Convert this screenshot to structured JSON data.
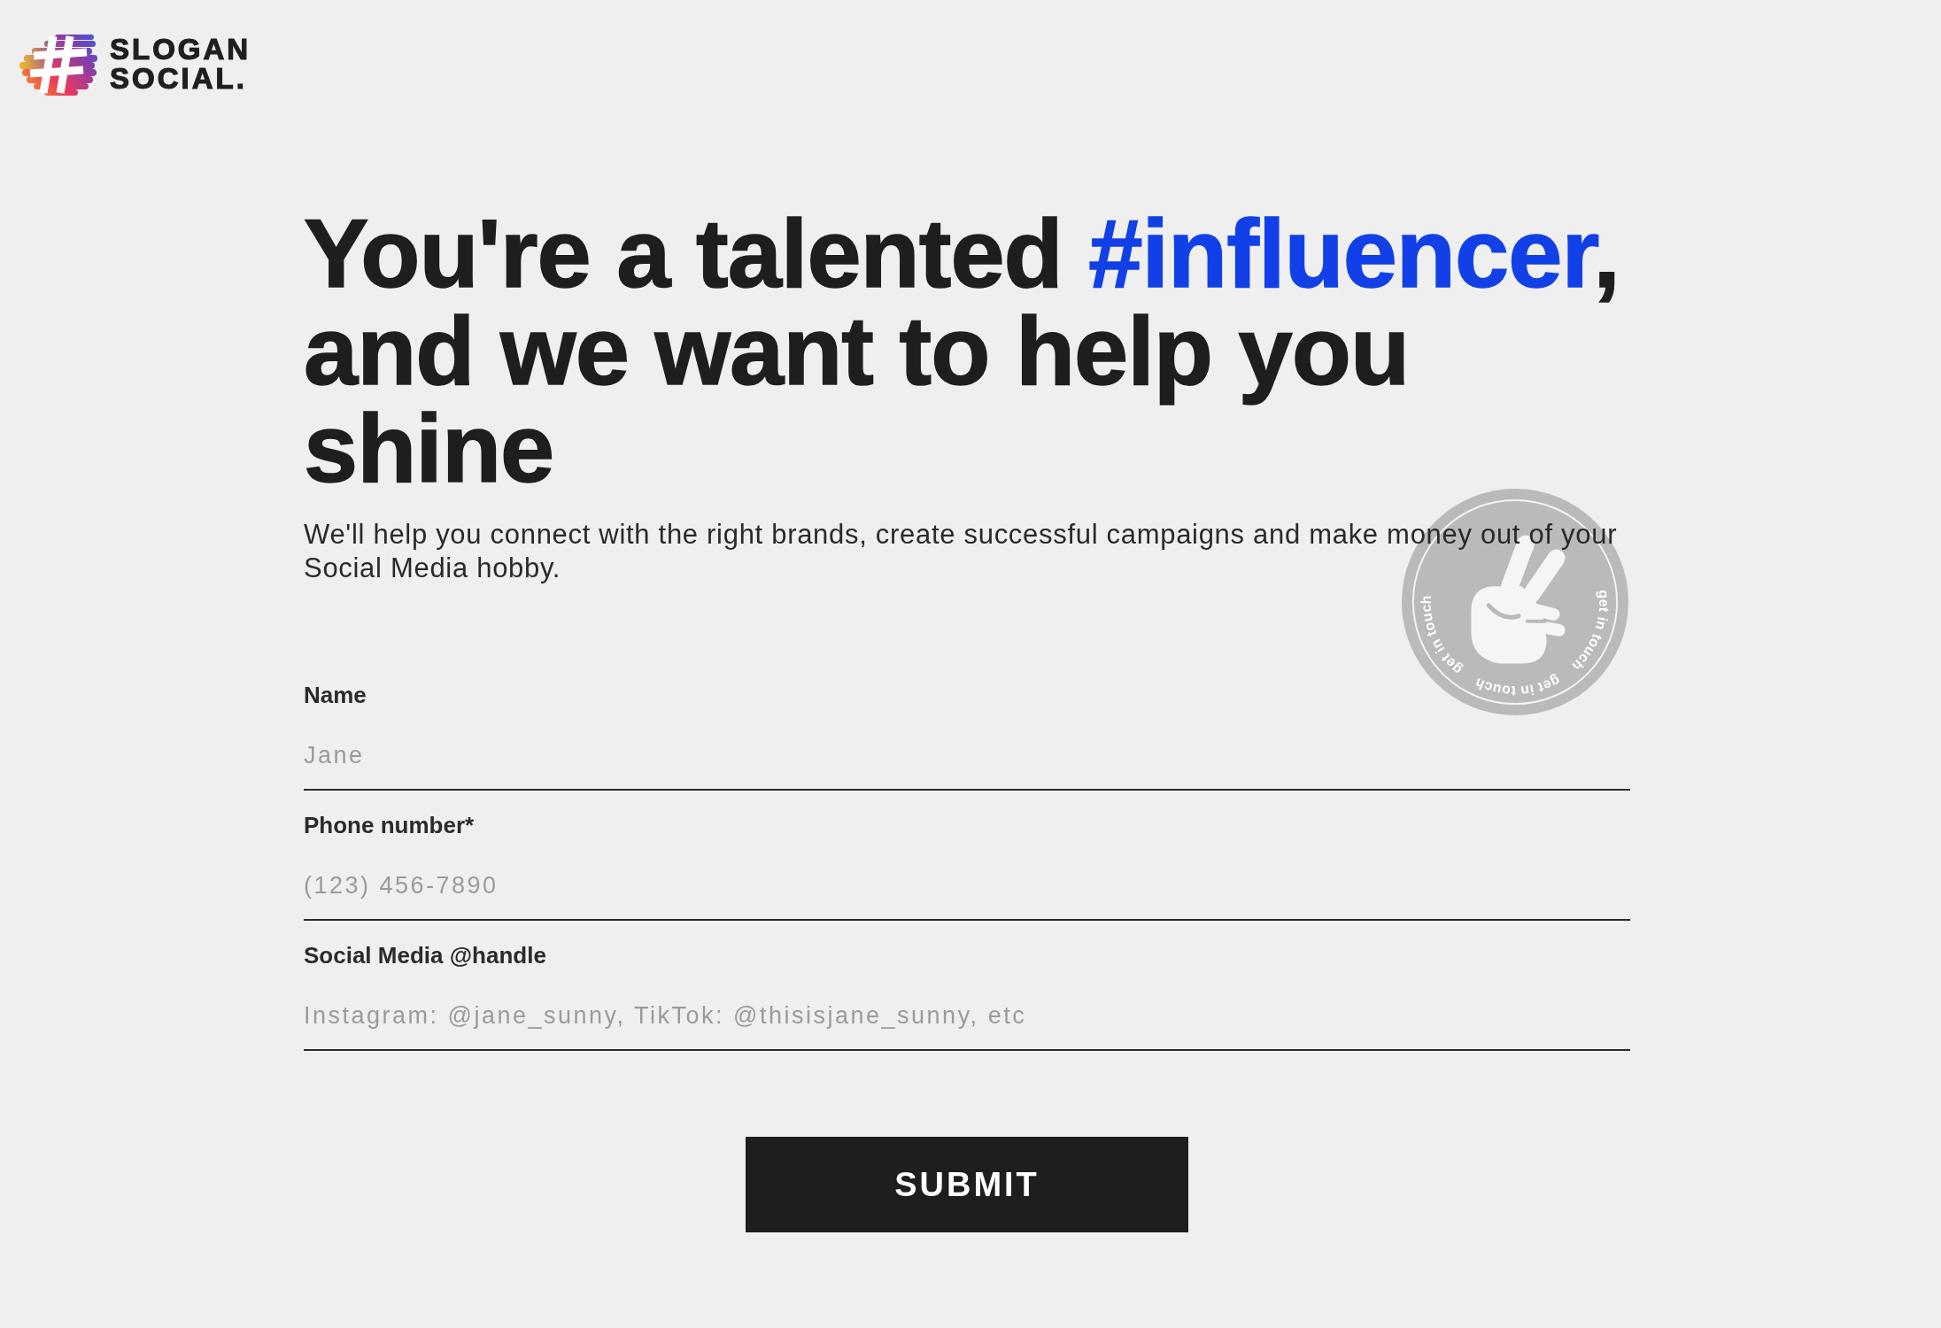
{
  "header": {
    "logo": {
      "name": "SLOGAN SOCIAL."
    }
  },
  "hero": {
    "headline": [
      {
        "text": "You're a talented ",
        "highlight": false
      },
      {
        "text": "#influencer",
        "highlight": true
      },
      {
        "text": ", and we want to help you shine",
        "highlight": false
      }
    ],
    "subtitle": "We'll help you connect with the right brands, create successful campaigns and make money out of your Social Media hobby.",
    "stamp": {
      "texts": [
        "get in touch",
        "get in touch",
        "get in touch"
      ]
    }
  },
  "form": {
    "fields": [
      {
        "label": "Name",
        "placeholder": "Jane"
      },
      {
        "label": "Phone number*",
        "placeholder": "(123) 456-7890"
      },
      {
        "label": "Social Media @handle",
        "placeholder": "Instagram: @jane_sunny, TikTok: @thisisjane_sunny, etc"
      }
    ],
    "submit": "SUBMIT"
  }
}
